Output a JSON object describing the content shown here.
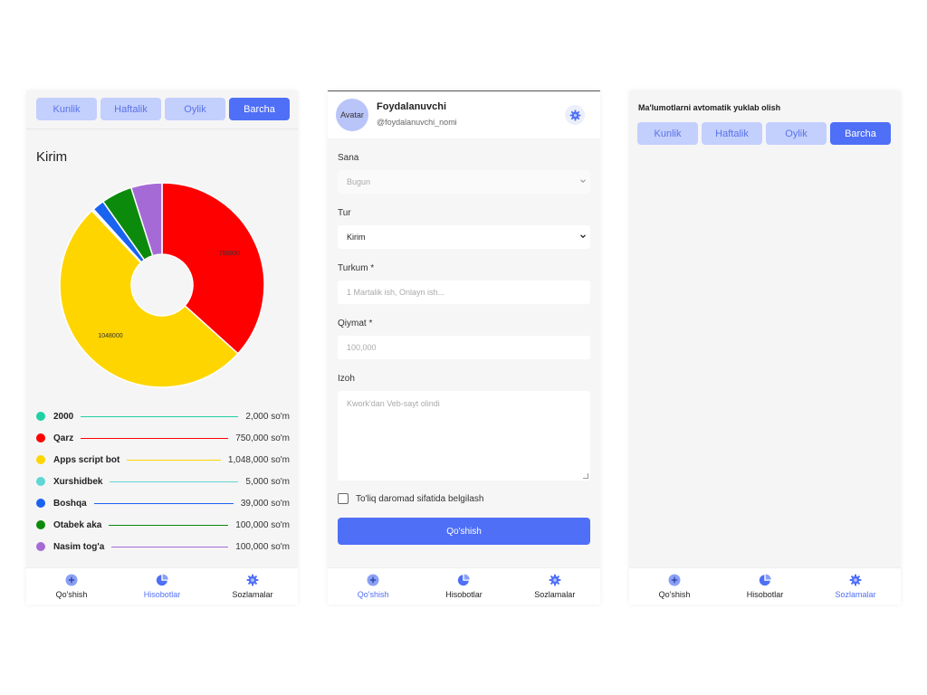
{
  "periods": [
    "Kunlik",
    "Haftalik",
    "Oylik",
    "Barcha"
  ],
  "active_period": "Barcha",
  "nav": [
    {
      "label": "Qo'shish",
      "icon": "plus-circle-icon"
    },
    {
      "label": "Hisobotlar",
      "icon": "pie-chart-icon"
    },
    {
      "label": "Sozlamalar",
      "icon": "gear-icon"
    }
  ],
  "colors": {
    "accent": "#4f6ff7",
    "accent_light": "#c3cffd"
  },
  "report": {
    "title": "Kirim",
    "legend": [
      {
        "name": "2000",
        "amount": "2,000 so'm",
        "color": "#1fd0a3"
      },
      {
        "name": "Qarz",
        "amount": "750,000 so'm",
        "color": "#ff0000"
      },
      {
        "name": "Apps script bot",
        "amount": "1,048,000 so'm",
        "color": "#ffd500"
      },
      {
        "name": "Xurshidbek",
        "amount": "5,000 so'm",
        "color": "#5ed6d6"
      },
      {
        "name": "Boshqa",
        "amount": "39,000 so'm",
        "color": "#1a62f0"
      },
      {
        "name": "Otabek aka",
        "amount": "100,000 so'm",
        "color": "#0c8a0c"
      },
      {
        "name": "Nasim tog'a",
        "amount": "100,000 so'm",
        "color": "#a66ad6"
      }
    ]
  },
  "chart_data": {
    "type": "pie",
    "categories": [
      "2000",
      "Qarz",
      "Apps script bot",
      "Xurshidbek",
      "Boshqa",
      "Otabek aka",
      "Nasim tog'a"
    ],
    "values": [
      2000,
      750000,
      1048000,
      5000,
      39000,
      100000,
      100000
    ],
    "labels": [
      "",
      "750000",
      "1048000",
      "",
      "",
      "",
      ""
    ],
    "colors": [
      "#1fd0a3",
      "#ff0000",
      "#ffd500",
      "#5ed6d6",
      "#1a62f0",
      "#0c8a0c",
      "#a66ad6"
    ],
    "donut": true
  },
  "profile": {
    "avatar_alt": "Avatar",
    "name": "Foydalanuvchi",
    "handle": "@foydalanuvchi_nomi"
  },
  "form": {
    "date_label": "Sana",
    "date_value": "Bugun",
    "type_label": "Tur",
    "type_value": "Kirim",
    "category_label": "Turkum *",
    "category_placeholder": "1 Martalik ish, Onlayn ish...",
    "amount_label": "Qiymat *",
    "amount_placeholder": "100,000",
    "note_label": "Izoh",
    "note_placeholder": "Kwork'dan Veb-sayt olindi",
    "checkbox_label": "To'liq daromad sifatida belgilash",
    "submit_label": "Qo'shish"
  },
  "auto_download": {
    "title": "Ma'lumotlarni avtomatik yuklab olish"
  }
}
